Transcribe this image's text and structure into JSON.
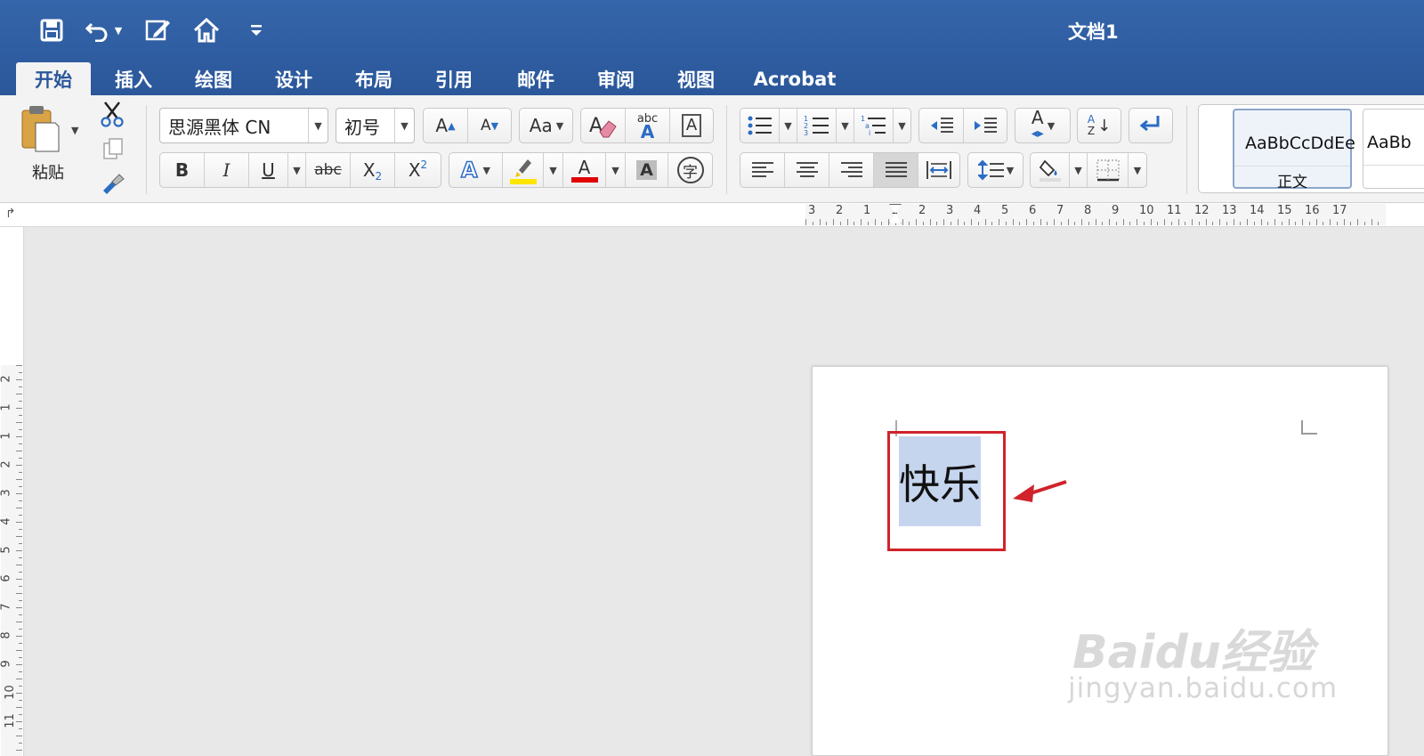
{
  "titlebar": {
    "doc_title": "文档1"
  },
  "tabs": [
    {
      "label": "开始",
      "active": true
    },
    {
      "label": "插入"
    },
    {
      "label": "绘图"
    },
    {
      "label": "设计"
    },
    {
      "label": "布局"
    },
    {
      "label": "引用"
    },
    {
      "label": "邮件"
    },
    {
      "label": "审阅"
    },
    {
      "label": "视图"
    },
    {
      "label": "Acrobat"
    }
  ],
  "ribbon": {
    "paste_label": "粘贴",
    "font_name": "思源黑体 CN",
    "font_size": "初号",
    "bold": "B",
    "italic": "I",
    "underline": "U",
    "strike": "abc",
    "clear_format_sample": "abc",
    "styles": [
      {
        "sample": "AaBbCcDdEe",
        "name": "正文"
      },
      {
        "sample": "AaBb",
        "name": ""
      }
    ]
  },
  "ruler": {
    "horizontal": [
      "3",
      "2",
      "1",
      "1",
      "2",
      "3",
      "4",
      "5",
      "6",
      "7",
      "8",
      "9",
      "10",
      "11",
      "12",
      "13",
      "14",
      "15",
      "16",
      "17"
    ],
    "vertical": [
      "2",
      "1",
      "1",
      "2",
      "3",
      "4",
      "5",
      "6",
      "7",
      "8",
      "9",
      "10",
      "11"
    ]
  },
  "document": {
    "selected_text": "快乐"
  },
  "watermark": {
    "brand": "Baidu经验",
    "url": "jingyan.baidu.com"
  },
  "colors": {
    "titlebar": "#2b579a",
    "selection": "#c6d5ee",
    "annotation_red": "#d0232b",
    "highlight_yellow": "#ffe600",
    "font_color_red": "#e00000"
  }
}
